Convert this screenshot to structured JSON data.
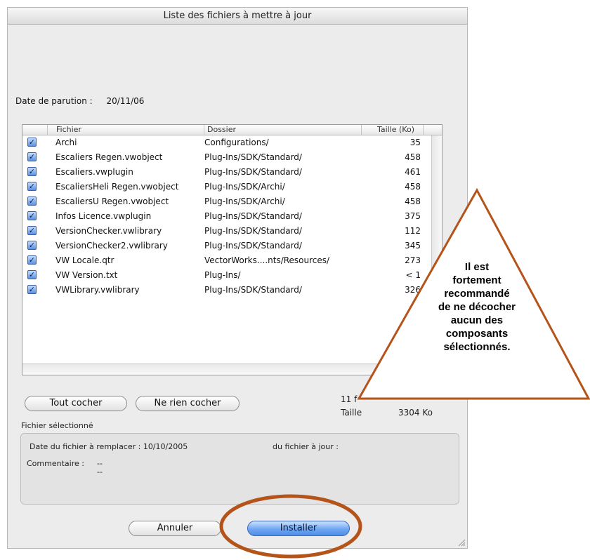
{
  "window": {
    "title": "Liste des fichiers à mettre à jour"
  },
  "release": {
    "label": "Date de parution :",
    "value": "20/11/06"
  },
  "table": {
    "columns": [
      "Fichier",
      "Dossier",
      "Taille (Ko)"
    ],
    "rows": [
      {
        "checked": true,
        "file": "Archi",
        "folder": "Configurations/",
        "size": "35"
      },
      {
        "checked": true,
        "file": "Escaliers Regen.vwobject",
        "folder": "Plug-Ins/SDK/Standard/",
        "size": "458"
      },
      {
        "checked": true,
        "file": "Escaliers.vwplugin",
        "folder": "Plug-Ins/SDK/Standard/",
        "size": "461"
      },
      {
        "checked": true,
        "file": "EscaliersHeli Regen.vwobject",
        "folder": "Plug-Ins/SDK/Archi/",
        "size": "458"
      },
      {
        "checked": true,
        "file": "EscaliersU Regen.vwobject",
        "folder": "Plug-Ins/SDK/Archi/",
        "size": "458"
      },
      {
        "checked": true,
        "file": "Infos Licence.vwplugin",
        "folder": "Plug-Ins/SDK/Standard/",
        "size": "375"
      },
      {
        "checked": true,
        "file": "VersionChecker.vwlibrary",
        "folder": "Plug-Ins/SDK/Standard/",
        "size": "112"
      },
      {
        "checked": true,
        "file": "VersionChecker2.vwlibrary",
        "folder": "Plug-Ins/SDK/Standard/",
        "size": "345"
      },
      {
        "checked": true,
        "file": "VW Locale.qtr",
        "folder": "VectorWorks....nts/Resources/",
        "size": "273"
      },
      {
        "checked": true,
        "file": "VW Version.txt",
        "folder": "Plug-Ins/",
        "size": "< 1"
      },
      {
        "checked": true,
        "file": "VWLibrary.vwlibrary",
        "folder": "Plug-Ins/SDK/Standard/",
        "size": "326"
      }
    ]
  },
  "buttons": {
    "check_all": "Tout cocher",
    "check_none": "Ne rien cocher",
    "cancel": "Annuler",
    "install": "Installer"
  },
  "summary": {
    "count_prefix": "11 f",
    "size_label": "Taille",
    "size_value": "3304 Ko"
  },
  "selected_file": {
    "section_label": "Fichier sélectionné",
    "date_replace_label": "Date du fichier à remplacer : 10/10/2005",
    "date_update_label": "du fichier à jour :",
    "comment_label": "Commentaire :",
    "comment_line1": "--",
    "comment_line2": "--"
  },
  "annotation": {
    "lines": [
      "Il est",
      "fortement",
      "recommandé",
      "de ne décocher",
      "aucun des",
      "composants",
      "sélectionnés."
    ],
    "color": "#b5541a"
  },
  "icons": [
    "checkbox-checked-icon",
    "resize-grip-icon",
    "warning-triangle-annotation",
    "highlight-ellipse-annotation"
  ]
}
